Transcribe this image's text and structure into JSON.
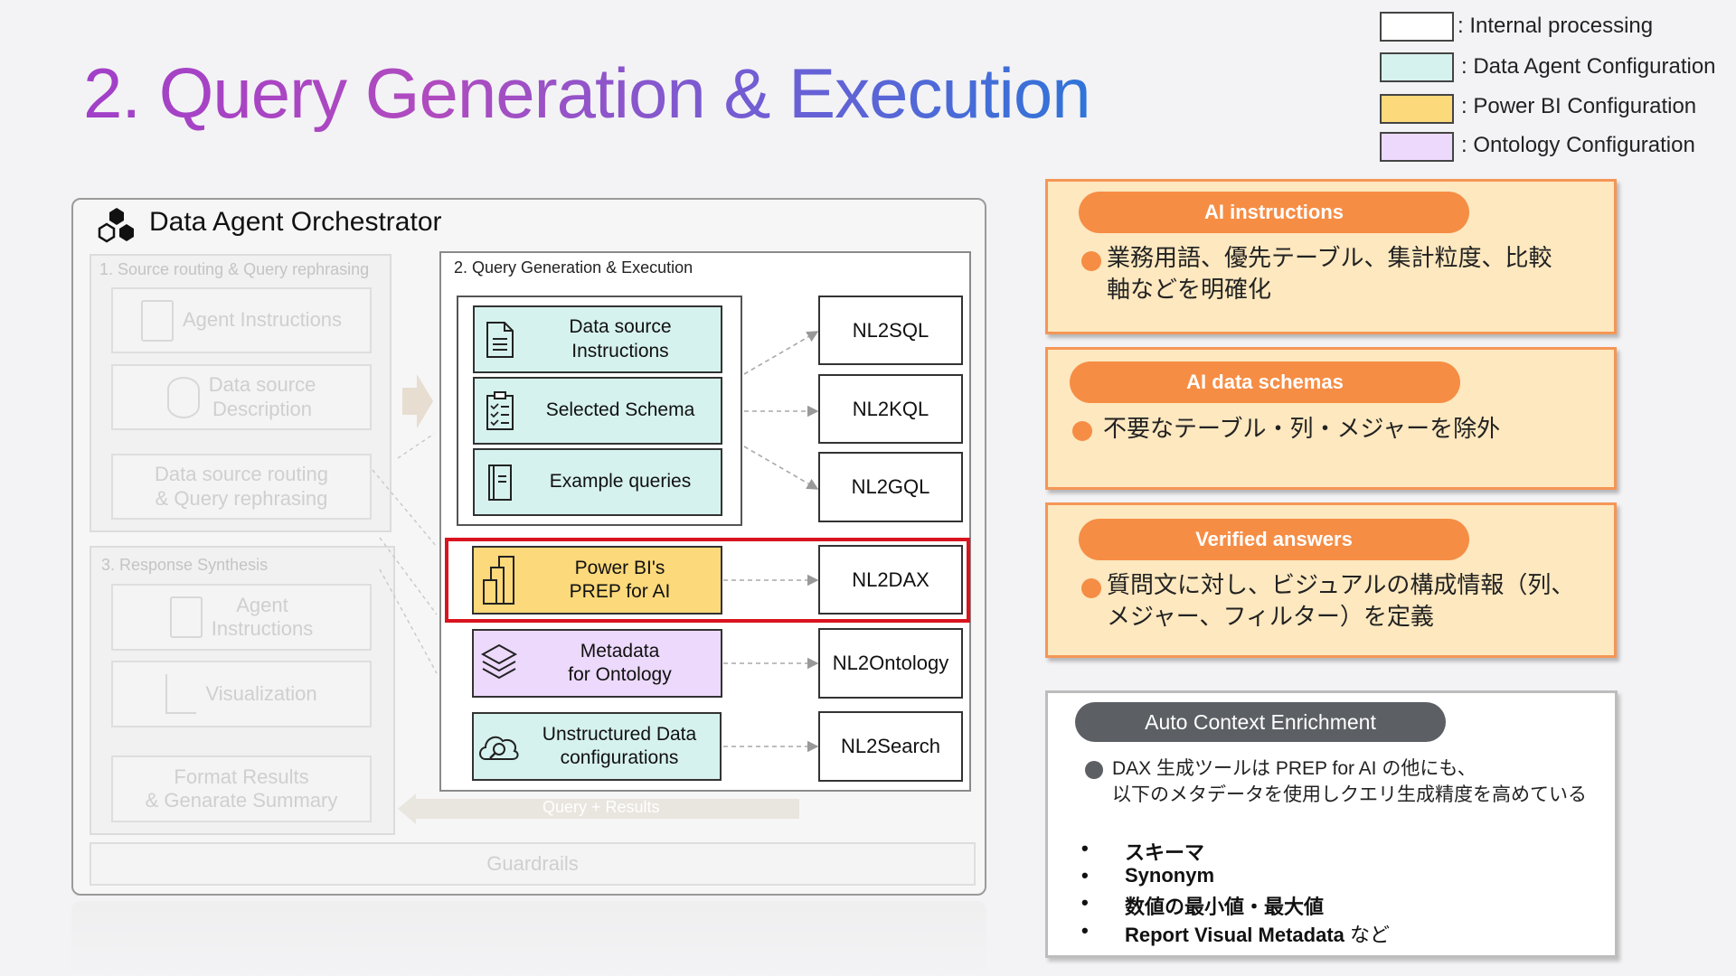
{
  "title": "2. Query Generation & Execution",
  "legend": [
    {
      "label": ": Internal processing",
      "color": "#ffffff"
    },
    {
      "label": ": Data Agent Configuration",
      "color": "#d6f2ee"
    },
    {
      "label": ": Power BI Configuration",
      "color": "#fcd97a"
    },
    {
      "label": ": Ontology Configuration",
      "color": "#ecd9fb"
    }
  ],
  "orchestrator": {
    "title": "Data Agent Orchestrator",
    "section1": {
      "heading": "1. Source routing & Query rephrasing",
      "items": [
        "Agent Instructions",
        "Data source\nDescription",
        "Data source routing\n& Query rephrasing"
      ]
    },
    "section3": {
      "heading": "3. Response Synthesis",
      "items": [
        "Agent\nInstructions",
        "Visualization",
        "Format Results\n& Genarate Summary"
      ]
    },
    "query_results": "Query + Results",
    "guardrails": "Guardrails"
  },
  "query_panel": {
    "heading": "2. Query Generation & Execution",
    "inputs": [
      {
        "label": "Data source\nInstructions",
        "icon": "document-icon"
      },
      {
        "label": "Selected Schema",
        "icon": "checklist-icon"
      },
      {
        "label": "Example queries",
        "icon": "notebook-icon"
      },
      {
        "label": "Power BI's\nPREP for AI",
        "icon": "bar-chart-icon"
      },
      {
        "label": "Metadata\nfor Ontology",
        "icon": "layers-icon"
      },
      {
        "label": "Unstructured Data\nconfigurations",
        "icon": "cloud-search-icon"
      }
    ],
    "outputs": [
      "NL2SQL",
      "NL2KQL",
      "NL2GQL",
      "NL2DAX",
      "NL2Ontology",
      "NL2Search"
    ]
  },
  "cards": [
    {
      "pill": "AI instructions",
      "text": "業務用語、優先テーブル、集計粒度、比較\n軸などを明確化"
    },
    {
      "pill": "AI data schemas",
      "text": "不要なテーブル・列・メジャーを除外"
    },
    {
      "pill": "Verified answers",
      "text": "質問文に対し、ビジュアルの構成情報（列、\nメジャー、フィルター）を定義"
    }
  ],
  "auto": {
    "pill": "Auto Context Enrichment",
    "text": "DAX 生成ツールは PREP for AI の他にも、\n以下のメタデータを使用しクエリ生成精度を高めている",
    "items": [
      "スキーマ",
      "Synonym",
      "数値の最小値・最大値",
      "Report Visual Metadata"
    ],
    "last_suffix": " など"
  }
}
